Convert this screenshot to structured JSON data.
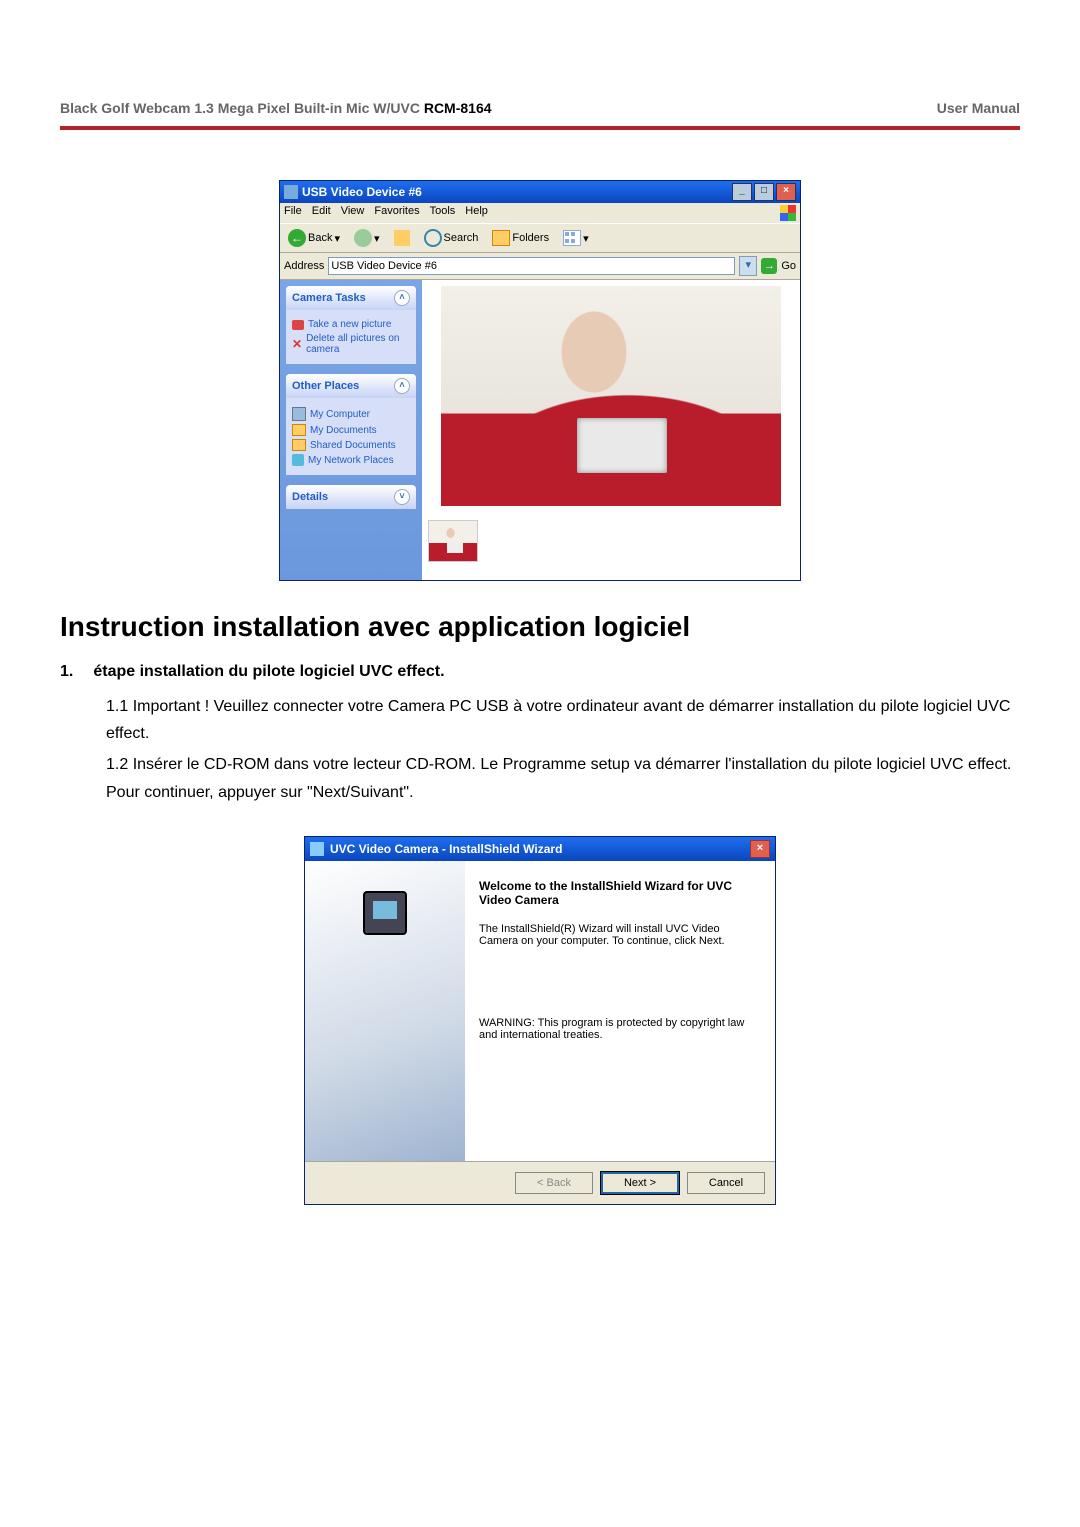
{
  "header": {
    "left_gray": "Black Golf Webcam 1.3 Mega Pixel Built-in Mic W/UVC ",
    "left_model": "RCM-8164",
    "right": "User Manual"
  },
  "xp": {
    "title": "USB Video Device #6",
    "menus": [
      "File",
      "Edit",
      "View",
      "Favorites",
      "Tools",
      "Help"
    ],
    "toolbar": {
      "back": "Back",
      "search": "Search",
      "folders": "Folders"
    },
    "address_label": "Address",
    "address_value": "USB Video Device #6",
    "go": "Go",
    "camera_tasks": {
      "title": "Camera Tasks",
      "items": [
        "Take a new picture",
        "Delete all pictures on camera"
      ]
    },
    "other_places": {
      "title": "Other Places",
      "items": [
        "My Computer",
        "My Documents",
        "Shared Documents",
        "My Network Places"
      ]
    },
    "details": {
      "title": "Details"
    }
  },
  "doc": {
    "heading": "Instruction installation avec application logiciel",
    "step1_num": "1.",
    "step1_title": "étape installation du pilote logiciel UVC effect.",
    "p11": "1.1 Important ! Veuillez connecter votre Camera PC USB à votre ordinateur avant de démarrer installation du pilote logiciel UVC effect.",
    "p12": "1.2 Insérer le CD-ROM dans votre lecteur CD-ROM. Le Programme setup va démarrer l'installation du pilote logiciel UVC effect. Pour continuer, appuyer sur \"Next/Suivant\"."
  },
  "wizard": {
    "title": "UVC Video Camera - InstallShield Wizard",
    "welcome": "Welcome to the InstallShield Wizard for UVC Video Camera",
    "body": "The InstallShield(R) Wizard will install UVC Video Camera on your computer. To continue, click Next.",
    "warn": "WARNING: This program is protected by copyright law and international treaties.",
    "back": "< Back",
    "next": "Next >",
    "cancel": "Cancel"
  }
}
